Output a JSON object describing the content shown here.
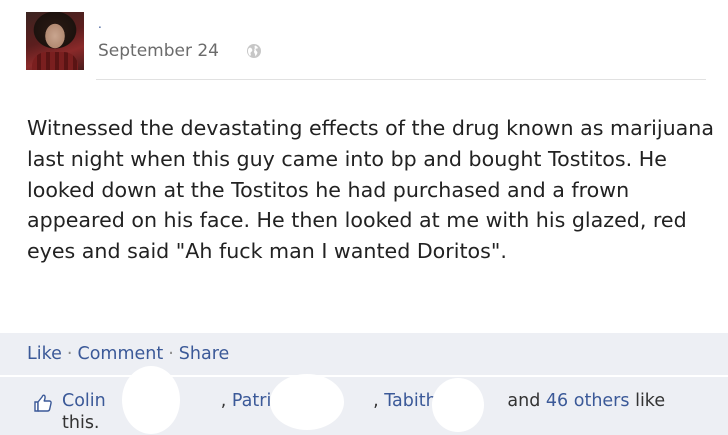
{
  "post": {
    "author_name": ".",
    "timestamp": "September 24",
    "audience_icon": "globe-icon",
    "text": "Witnessed the devastating effects of the drug known as marijuana last night when this guy came into bp and bought Tostitos. He looked down at the Tostitos he had purchased and a frown appeared on his face. He then looked at me with his glazed, red eyes and said \"Ah fuck man I wanted Doritos\"."
  },
  "actions": {
    "like": "Like",
    "comment": "Comment",
    "share": "Share",
    "separator": "·"
  },
  "likes": {
    "icon": "thumbs-up-icon",
    "names": [
      "Colin",
      "Patrick",
      "Tabitha"
    ],
    "comma": ",",
    "and_text": "and",
    "others_link": "46 others",
    "suffix": "like this."
  },
  "colors": {
    "link": "#3b5998",
    "bar_background": "#edeff4",
    "text": "#222222",
    "timestamp": "#6b6b6b"
  }
}
